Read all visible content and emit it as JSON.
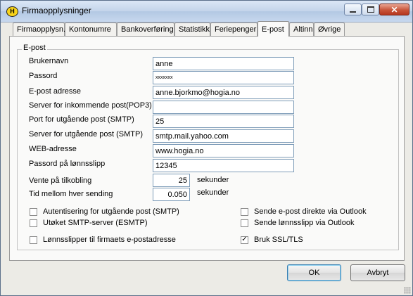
{
  "window": {
    "title": "Firmaopplysninger",
    "app_icon_letter": "H",
    "close_glyph": "✕"
  },
  "tabs": [
    {
      "label": "Firmaopplysn."
    },
    {
      "label": "Kontonumre"
    },
    {
      "label": "Bankoverføring"
    },
    {
      "label": "Statistikk"
    },
    {
      "label": "Feriepenger"
    },
    {
      "label": "E-post",
      "active": true
    },
    {
      "label": "Altinn"
    },
    {
      "label": "Øvrige"
    }
  ],
  "group": {
    "title": "E-post"
  },
  "fields": {
    "username": {
      "label": "Brukernavn",
      "value": "anne"
    },
    "password": {
      "label": "Passord",
      "value": "xxxxxxx"
    },
    "email": {
      "label": "E-post adresse",
      "value": "anne.bjorkmo@hogia.no"
    },
    "pop3": {
      "label": "Server for inkommende post(POP3)",
      "value": ""
    },
    "smtp_port": {
      "label": "Port for utgående post (SMTP)",
      "value": "25"
    },
    "smtp_server": {
      "label": "Server for utgående post (SMTP)",
      "value": "smtp.mail.yahoo.com"
    },
    "web": {
      "label": "WEB-adresse",
      "value": "www.hogia.no"
    },
    "payslip_password": {
      "label": "Passord på lønnsslipp",
      "value": "12345"
    },
    "wait_connect": {
      "label": "Vente på tilkobling",
      "value": "25",
      "unit": "sekunder"
    },
    "send_interval": {
      "label": "Tid mellom hver sending",
      "value": "0.050",
      "unit": "sekunder"
    }
  },
  "checkboxes": {
    "smtp_auth": {
      "label": "Autentisering for utgående post (SMTP)",
      "checked": false
    },
    "esmtp": {
      "label": "Utøket SMTP-server (ESMTP)",
      "checked": false
    },
    "payslips_company": {
      "label": "Lønnsslipper til firmaets e-postadresse",
      "checked": false
    },
    "send_outlook": {
      "label": "Sende e-post direkte via Outlook",
      "checked": false
    },
    "payslip_outlook": {
      "label": "Sende lønnsslipp via Outlook",
      "checked": false
    },
    "ssl_tls": {
      "label": "Bruk SSL/TLS",
      "checked": true,
      "mark": "✓"
    }
  },
  "buttons": {
    "ok": "OK",
    "cancel": "Avbryt"
  }
}
